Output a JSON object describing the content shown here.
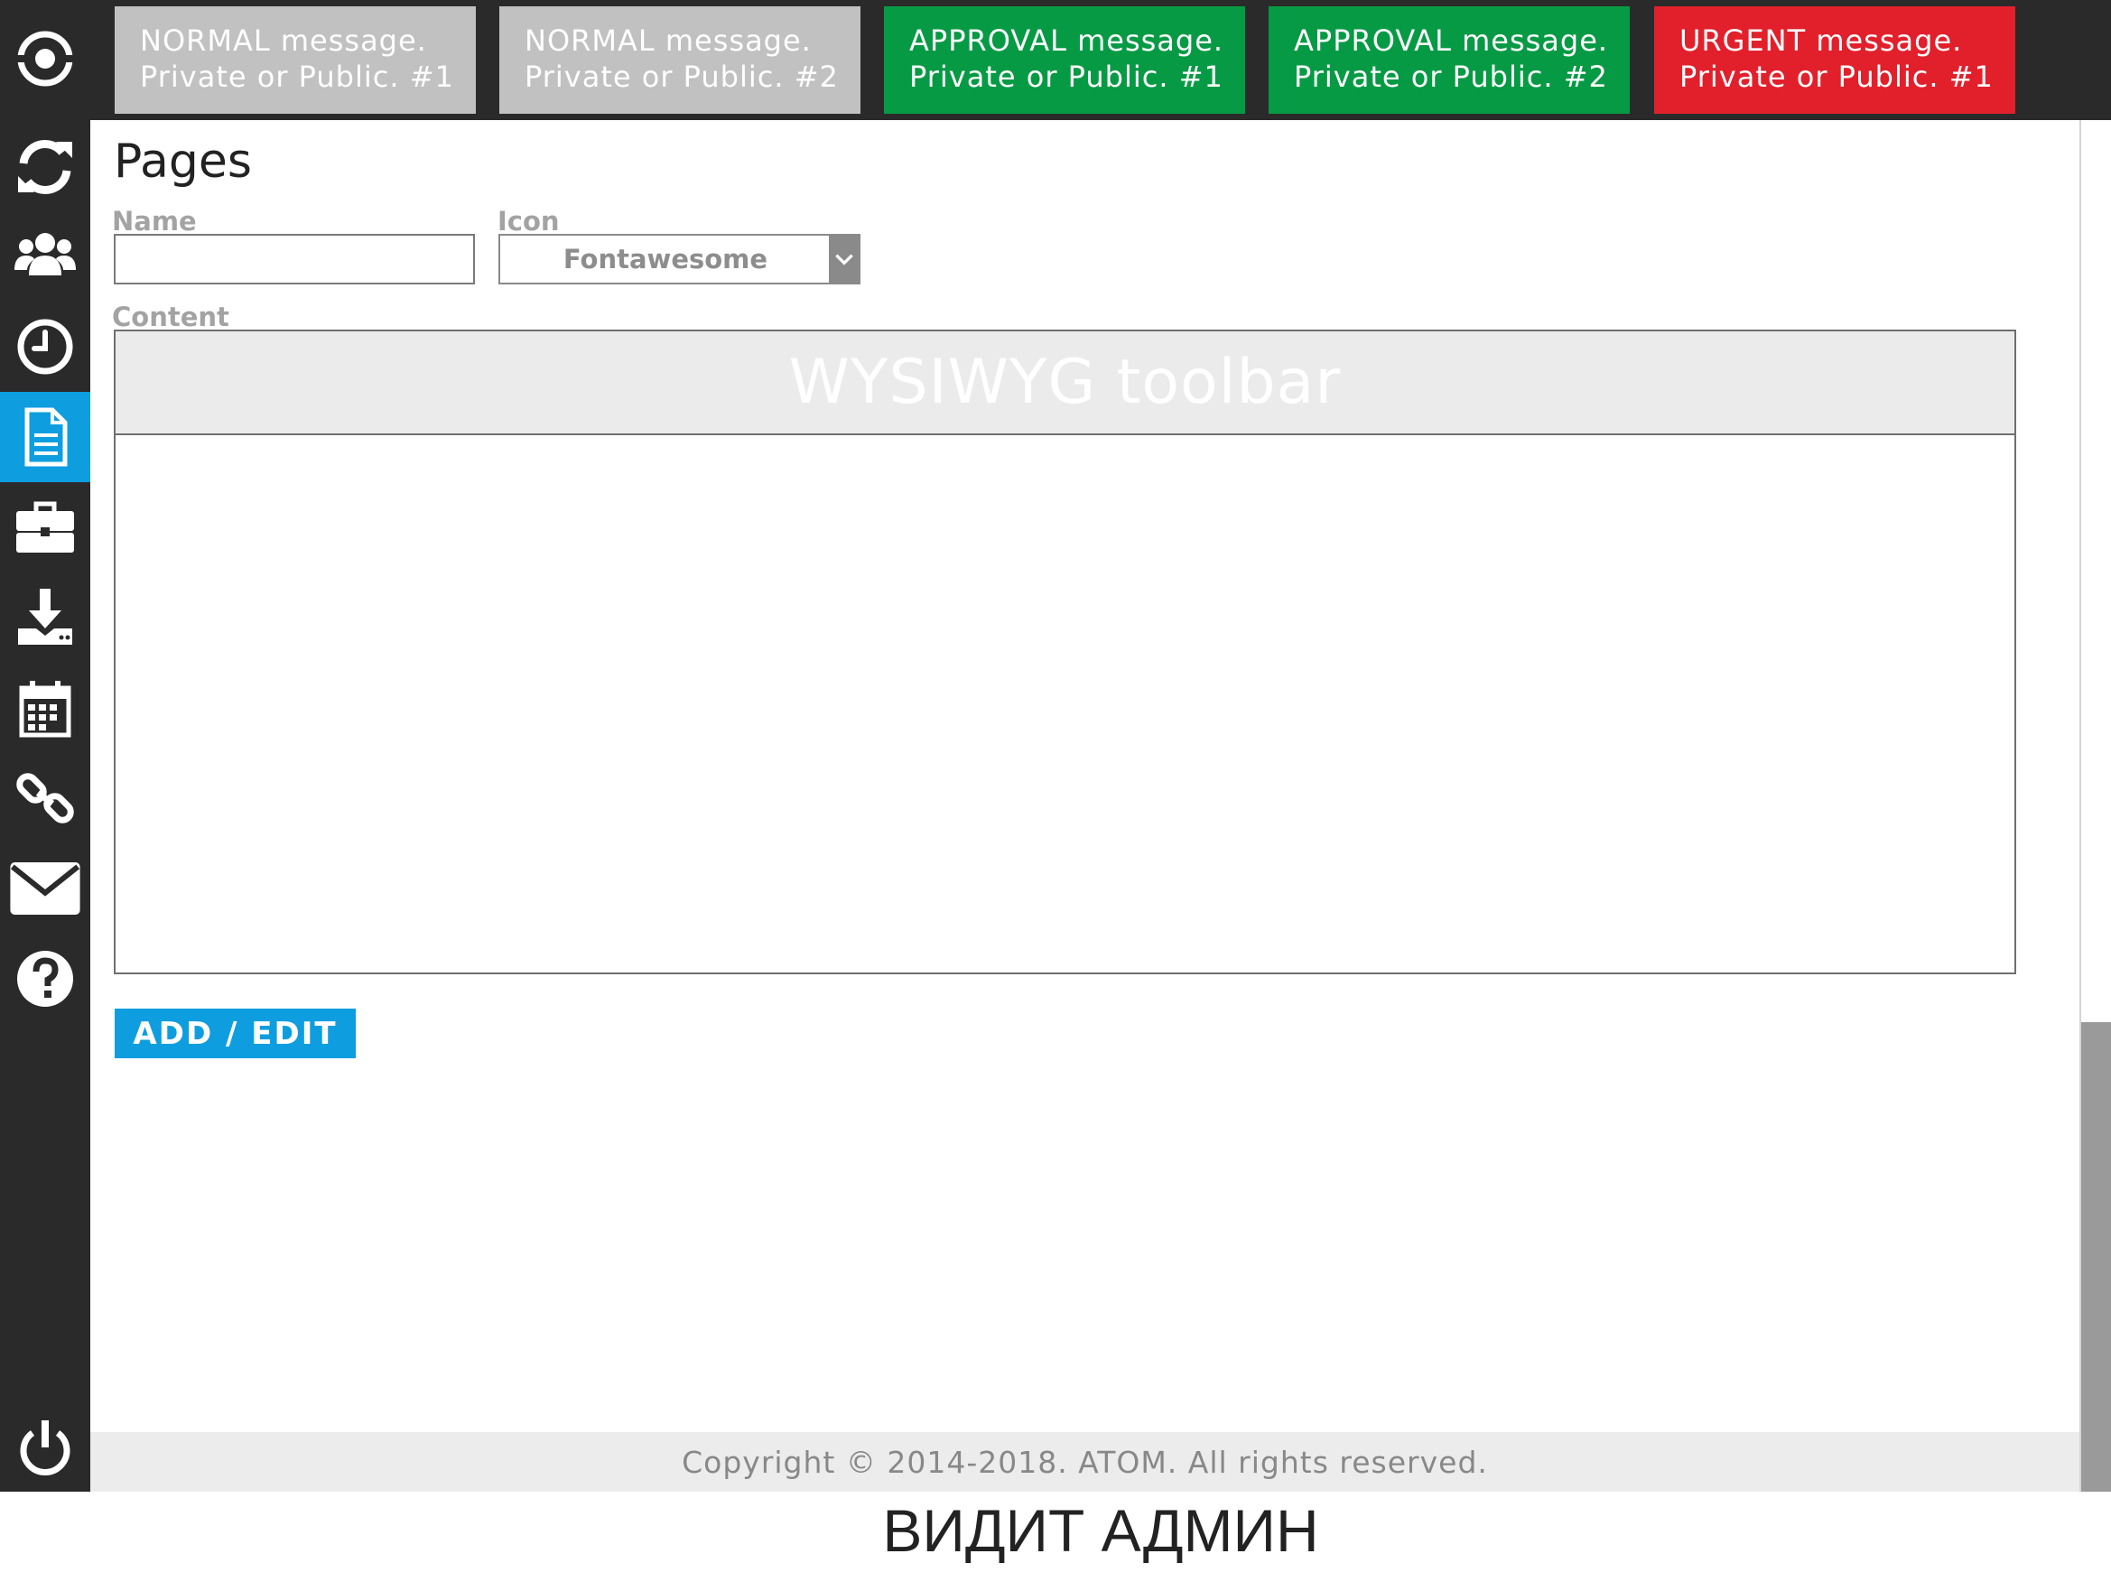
{
  "sidebar": {
    "items": [
      {
        "name": "logo-icon",
        "active": false
      },
      {
        "name": "refresh-icon",
        "active": false
      },
      {
        "name": "users-icon",
        "active": false
      },
      {
        "name": "clock-icon",
        "active": false
      },
      {
        "name": "document-icon",
        "active": true
      },
      {
        "name": "briefcase-icon",
        "active": false
      },
      {
        "name": "download-icon",
        "active": false
      },
      {
        "name": "calendar-icon",
        "active": false
      },
      {
        "name": "link-icon",
        "active": false
      },
      {
        "name": "mail-icon",
        "active": false
      },
      {
        "name": "help-icon",
        "active": false
      },
      {
        "name": "power-icon",
        "active": false
      }
    ],
    "active_color": "#0e9ee0",
    "background_color": "#2a2a2a"
  },
  "messages": [
    {
      "type": "normal",
      "line1": "NORMAL message.",
      "line2": "Private or Public. #1",
      "color": "#c1c1c1"
    },
    {
      "type": "normal",
      "line1": "NORMAL message.",
      "line2": "Private or Public. #2",
      "color": "#c1c1c1"
    },
    {
      "type": "approval",
      "line1": "APPROVAL message.",
      "line2": "Private or Public. #1",
      "color": "#079a44"
    },
    {
      "type": "approval",
      "line1": "APPROVAL message.",
      "line2": "Private or Public. #2",
      "color": "#079a44"
    },
    {
      "type": "urgent",
      "line1": "URGENT message.",
      "line2": "Private or Public. #1",
      "color": "#e2202b"
    }
  ],
  "page": {
    "title": "Pages"
  },
  "form": {
    "name_label": "Name",
    "name_value": "",
    "icon_label": "Icon",
    "icon_value": "Fontawesome",
    "content_label": "Content",
    "toolbar_placeholder": "WYSIWYG toolbar",
    "content_value": "",
    "submit_label": "ADD / EDIT"
  },
  "footer": {
    "copyright": "Copyright © 2014-2018. ATOM. All rights reserved."
  },
  "caption": "ВИДИТ АДМИН"
}
